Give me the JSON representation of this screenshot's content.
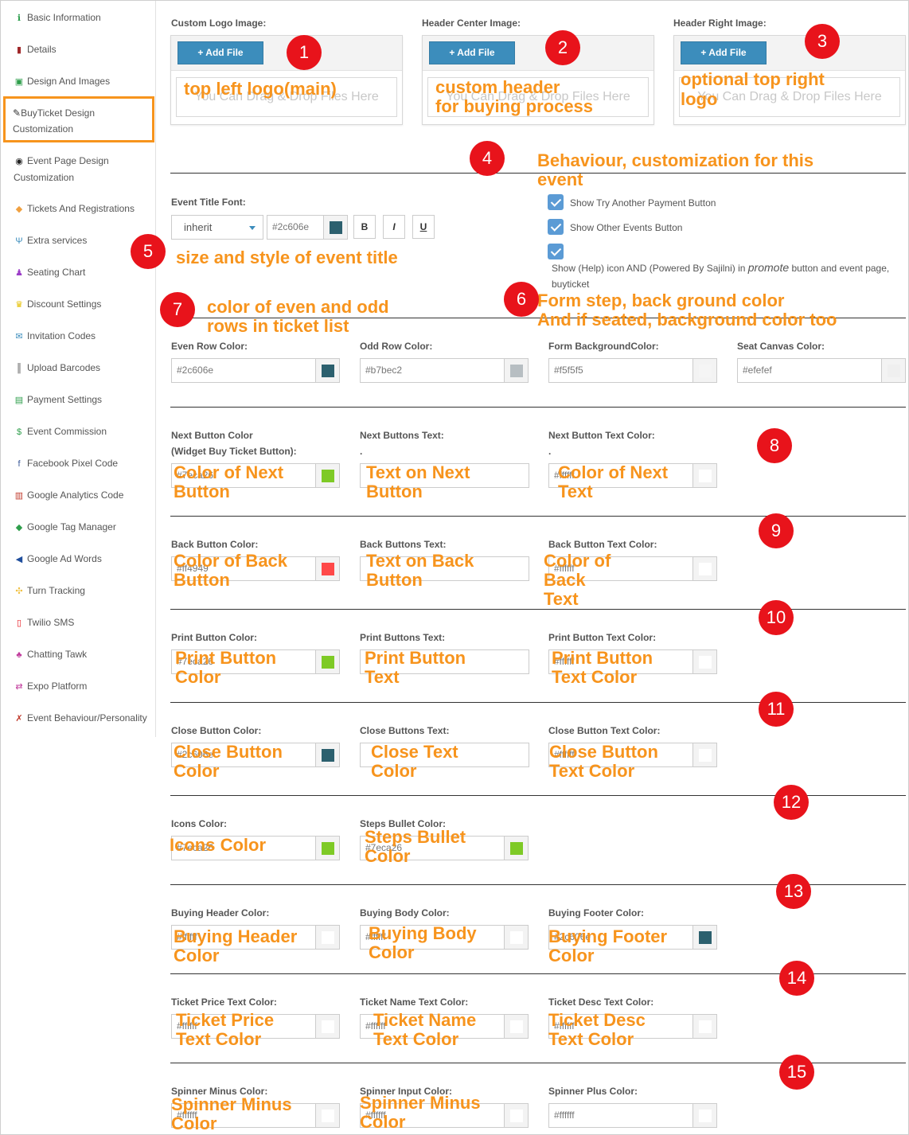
{
  "sidebar": {
    "items": [
      {
        "icon": "info-icon",
        "glyph": "ℹ",
        "color": "#2a9d4b",
        "label": "Basic Information"
      },
      {
        "icon": "bookmark-icon",
        "glyph": "▮",
        "color": "#a0282a",
        "label": "Details"
      },
      {
        "icon": "image-icon",
        "glyph": "▣",
        "color": "#2e9e4b",
        "label": "Design And Images"
      },
      {
        "icon": "magic-wand-icon",
        "glyph": "✎",
        "color": "#333333",
        "label": "BuyTicket Design Customization"
      },
      {
        "icon": "eye-icon",
        "glyph": "◉",
        "color": "#222222",
        "label": "Event Page Design Customization"
      },
      {
        "icon": "ticket-icon",
        "glyph": "◆",
        "color": "#f0a040",
        "label": "Tickets And Registrations"
      },
      {
        "icon": "utensils-icon",
        "glyph": "Ψ",
        "color": "#3c8dbc",
        "label": "Extra services"
      },
      {
        "icon": "person-icon",
        "glyph": "♟",
        "color": "#9c3ec8",
        "label": "Seating Chart"
      },
      {
        "icon": "trophy-icon",
        "glyph": "♛",
        "color": "#e6c000",
        "label": "Discount Settings"
      },
      {
        "icon": "envelope-icon",
        "glyph": "✉",
        "color": "#3c8dbc",
        "label": "Invitation Codes"
      },
      {
        "icon": "barcode-icon",
        "glyph": "║",
        "color": "#444444",
        "label": "Upload Barcodes"
      },
      {
        "icon": "money-icon",
        "glyph": "▤",
        "color": "#2e9e4b",
        "label": "Payment Settings"
      },
      {
        "icon": "dollar-icon",
        "glyph": "$",
        "color": "#2e9e4b",
        "label": "Event Commission"
      },
      {
        "icon": "facebook-icon",
        "glyph": "f",
        "color": "#3b5998",
        "label": "Facebook Pixel Code"
      },
      {
        "icon": "bar-chart-icon",
        "glyph": "▥",
        "color": "#c0392b",
        "label": "Google Analytics Code"
      },
      {
        "icon": "tag-icon",
        "glyph": "◆",
        "color": "#2e9e4b",
        "label": "Google Tag Manager"
      },
      {
        "icon": "bullhorn-icon",
        "glyph": "◀",
        "color": "#1f4e9c",
        "label": "Google Ad Words"
      },
      {
        "icon": "crosshair-icon",
        "glyph": "✣",
        "color": "#f0c040",
        "label": "Turn Tracking"
      },
      {
        "icon": "mobile-icon",
        "glyph": "▯",
        "color": "#e8131b",
        "label": "Twilio SMS"
      },
      {
        "icon": "sitemap-icon",
        "glyph": "♣",
        "color": "#c0399b",
        "label": "Chatting Tawk"
      },
      {
        "icon": "exchange-icon",
        "glyph": "⇄",
        "color": "#c0399b",
        "label": "Expo Platform"
      },
      {
        "icon": "wrench-icon",
        "glyph": "✗",
        "color": "#c0392b",
        "label": "Event Behaviour/Personality"
      }
    ]
  },
  "uploads": [
    {
      "label": "Custom Logo Image:",
      "button": "+ Add File",
      "drop": "You Can Drag & Drop Files Here"
    },
    {
      "label": "Header Center Image:",
      "button": "+ Add File",
      "drop": "You Can Drag & Drop Files Here"
    },
    {
      "label": "Header Right Image:",
      "button": "+ Add File",
      "drop": "You Can Drag & Drop Files Here"
    }
  ],
  "title_font": {
    "label": "Event Title Font:",
    "font": "inherit",
    "color_value": "#2c606e",
    "color": "#2c606e",
    "bold": "B",
    "italic": "I",
    "underline": "U"
  },
  "checkboxes": [
    {
      "label": "Show Try Another Payment Button"
    },
    {
      "label": "Show Other Events Button"
    },
    {
      "label_a": "Show (Help) icon AND (Powered By Sajilni) in ",
      "label_em": "promote",
      "label_b": " button and event page,",
      "label_c": "buyticket"
    }
  ],
  "rows": {
    "r1": [
      {
        "label": "Even Row Color:",
        "value": "#2c606e",
        "color": "#2c606e"
      },
      {
        "label": "Odd Row Color:",
        "value": "#b7bec2",
        "color": "#b7bec2"
      },
      {
        "label": "Form BackgroundColor:",
        "value": "#f5f5f5",
        "color": "#f5f5f5"
      },
      {
        "label": "Seat Canvas Color:",
        "value": "#efefef",
        "color": "#efefef"
      }
    ],
    "next": [
      {
        "label": "Next Button Color",
        "label2": "(Widget Buy Ticket Button):",
        "value": "#7eca26",
        "color": "#7eca26"
      },
      {
        "label": "Next Buttons Text:",
        "label2": ".",
        "value": ""
      },
      {
        "label": "Next Button Text Color:",
        "label2": ".",
        "value": "#ffffff",
        "color": "#ffffff"
      }
    ],
    "back": [
      {
        "label": "Back Button Color:",
        "value": "#ff4949",
        "color": "#ff4949"
      },
      {
        "label": "Back Buttons Text:",
        "value": ""
      },
      {
        "label": "Back Button Text Color:",
        "value": "#ffffff",
        "color": "#ffffff"
      }
    ],
    "print": [
      {
        "label": "Print Button Color:",
        "value": "#7eca26",
        "color": "#7eca26"
      },
      {
        "label": "Print Buttons Text:",
        "value": ""
      },
      {
        "label": "Print Button Text Color:",
        "value": "#ffffff",
        "color": "#ffffff"
      }
    ],
    "close": [
      {
        "label": "Close Button Color:",
        "value": "#2c606e",
        "color": "#2c606e"
      },
      {
        "label": "Close Buttons Text:",
        "value": ""
      },
      {
        "label": "Close Button Text Color:",
        "value": "#ffffff",
        "color": "#ffffff"
      }
    ],
    "icons": [
      {
        "label": "Icons Color:",
        "value": "#7eca26",
        "color": "#7eca26"
      },
      {
        "label": "Steps Bullet Color:",
        "value": "#7eca26",
        "color": "#7eca26"
      }
    ],
    "buying": [
      {
        "label": "Buying Header Color:",
        "value": "#ffffff",
        "color": "#ffffff"
      },
      {
        "label": "Buying Body Color:",
        "value": "#ffffff",
        "color": "#ffffff"
      },
      {
        "label": "Buying Footer Color:",
        "value": "#2c606e",
        "color": "#2c606e"
      }
    ],
    "ticket": [
      {
        "label": "Ticket Price Text Color:",
        "value": "#ffffff",
        "color": "#ffffff"
      },
      {
        "label": "Ticket Name Text Color:",
        "value": "#ffffff",
        "color": "#ffffff"
      },
      {
        "label": "Ticket Desc Text Color:",
        "value": "#ffffff",
        "color": "#ffffff"
      }
    ],
    "spinner": [
      {
        "label": "Spinner Minus Color:",
        "value": "#ffffff",
        "color": "#ffffff"
      },
      {
        "label": "Spinner Input Color:",
        "value": "#ffffff",
        "color": "#ffffff"
      },
      {
        "label": "Spinner Plus Color:",
        "value": "#ffffff",
        "color": "#ffffff"
      }
    ]
  },
  "annotations": {
    "numbers": [
      "1",
      "2",
      "3",
      "4",
      "5",
      "6",
      "7",
      "8",
      "9",
      "10",
      "11",
      "12",
      "13",
      "14",
      "15"
    ],
    "n1": "top left logo(main)",
    "n2a": "custom header",
    "n2b": "for buying process",
    "n3a": "optional top right",
    "n3b": "logo",
    "n4a": "Behaviour, customization for this",
    "n4b": "event",
    "n5": "size and style of event title",
    "n6a": "Form step, back ground color",
    "n6b": "And if seated, background color too",
    "n7a": "color of even and odd",
    "n7b": "rows in ticket list",
    "next": [
      "Color of Next\nButton",
      "Text on Next\nButton",
      "Color of Next\nText"
    ],
    "back": [
      "Color of Back\nButton",
      "Text on Back\nButton",
      "Color of\nBack\nText"
    ],
    "print": [
      "Print Button\nColor",
      "Print Button\nText",
      "Print Button\nText Color"
    ],
    "close": [
      "Close Button\nColor",
      "Close Text\nColor",
      "Close Button\nText Color"
    ],
    "icons": [
      "Icons Color",
      "Steps Bullet\nColor"
    ],
    "buying": [
      "Buying Header\nColor",
      "Buying Body\nColor",
      "Buying Footer\nColor"
    ],
    "ticket": [
      "Ticket Price\nText Color",
      "Ticket Name\nText Color",
      "Ticket Desc\nText Color"
    ],
    "spinner": [
      "Spinner Minus\nColor",
      "Spinner Minus\nColor"
    ]
  }
}
